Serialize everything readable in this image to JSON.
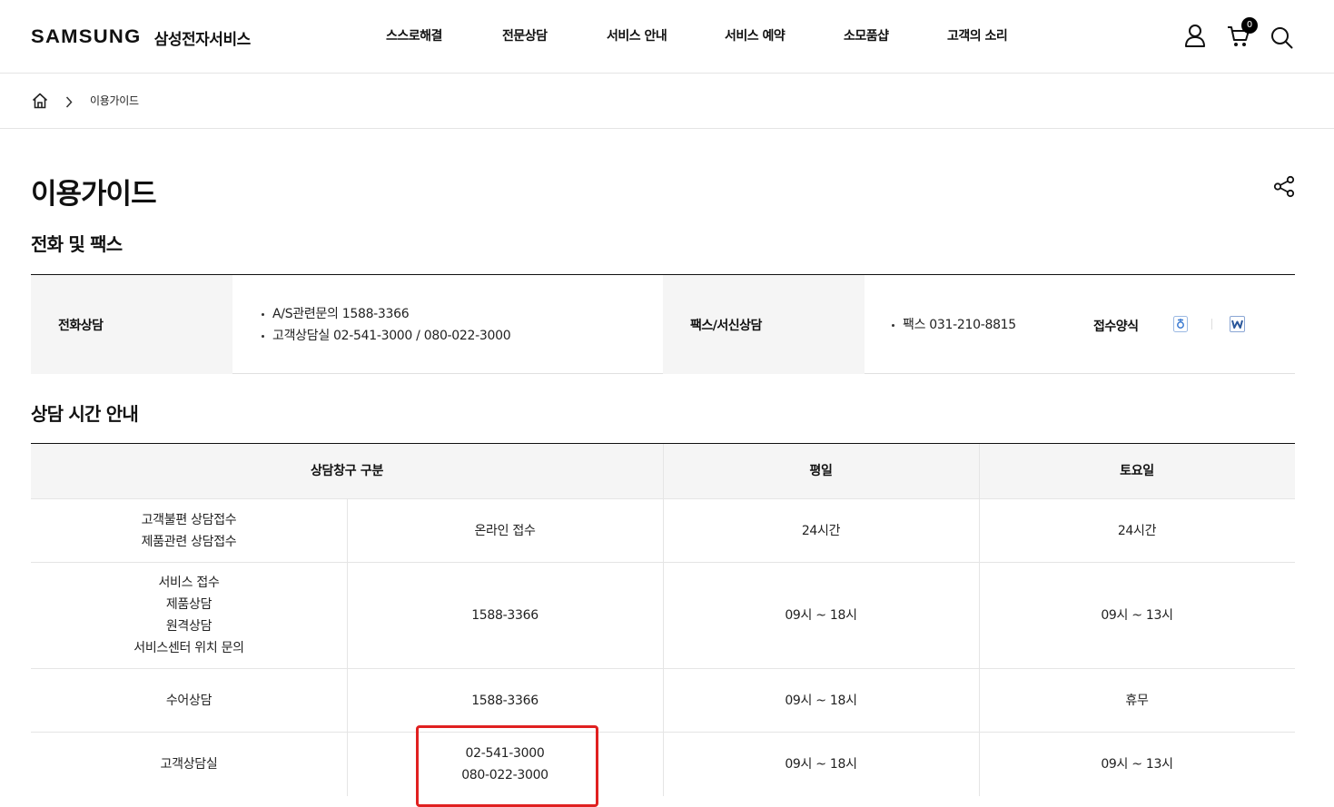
{
  "header": {
    "logo_word": "SAMSUNG",
    "logo_service": "삼성전자서비스",
    "nav": [
      "스스로해결",
      "전문상담",
      "서비스 안내",
      "서비스 예약",
      "소모품샵",
      "고객의 소리"
    ],
    "cart_count": "0"
  },
  "breadcrumb": {
    "current": "이용가이드"
  },
  "page_title": "이용가이드",
  "contact": {
    "section_title": "전화 및 팩스",
    "phone_label": "전화상담",
    "phone_items": [
      "A/S관련문의 1588-3366",
      "고객상담실 02-541-3000 / 080-022-3000"
    ],
    "fax_label": "팩스/서신상담",
    "fax_items": [
      "팩스 031-210-8815"
    ],
    "form_label": "접수양식"
  },
  "hours": {
    "section_title": "상담 시간 안내",
    "headers": [
      "상담창구 구분",
      "평일",
      "토요일"
    ],
    "rows": [
      {
        "category": [
          "고객불편 상담접수",
          "제품관련 상담접수"
        ],
        "channel": [
          "온라인 접수"
        ],
        "weekday": "24시간",
        "saturday": "24시간"
      },
      {
        "category": [
          "서비스 접수",
          "제품상담",
          "원격상담",
          "서비스센터 위치 문의"
        ],
        "channel": [
          "1588-3366"
        ],
        "weekday": "09시 ~ 18시",
        "saturday": "09시 ~ 13시"
      },
      {
        "category": [
          "수어상담"
        ],
        "channel": [
          "1588-3366"
        ],
        "weekday": "09시 ~ 18시",
        "saturday": "휴무"
      },
      {
        "category": [
          "고객상담실"
        ],
        "channel": [
          "02-541-3000",
          "080-022-3000"
        ],
        "weekday": "09시 ~ 18시",
        "saturday": "09시 ~ 13시"
      }
    ]
  },
  "colors": {
    "highlight": "#e02020",
    "header_bg": "#f5f5f5",
    "hwp_icon": "#3b7ad1",
    "word_icon": "#2b579a"
  }
}
